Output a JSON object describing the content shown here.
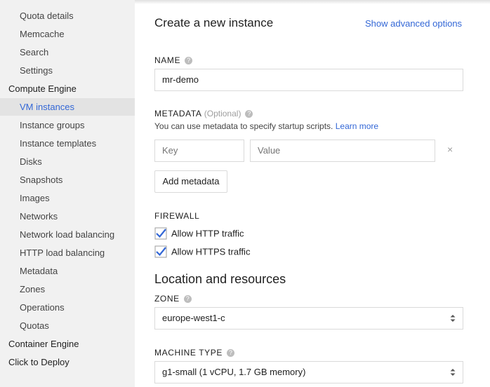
{
  "sidebar": {
    "items": [
      {
        "label": "Quota details",
        "kind": "item"
      },
      {
        "label": "Memcache",
        "kind": "item"
      },
      {
        "label": "Search",
        "kind": "item"
      },
      {
        "label": "Settings",
        "kind": "item"
      },
      {
        "label": "Compute Engine",
        "kind": "section"
      },
      {
        "label": "VM instances",
        "kind": "item",
        "active": true
      },
      {
        "label": "Instance groups",
        "kind": "item"
      },
      {
        "label": "Instance templates",
        "kind": "item"
      },
      {
        "label": "Disks",
        "kind": "item"
      },
      {
        "label": "Snapshots",
        "kind": "item"
      },
      {
        "label": "Images",
        "kind": "item"
      },
      {
        "label": "Networks",
        "kind": "item"
      },
      {
        "label": "Network load balancing",
        "kind": "item"
      },
      {
        "label": "HTTP load balancing",
        "kind": "item"
      },
      {
        "label": "Metadata",
        "kind": "item"
      },
      {
        "label": "Zones",
        "kind": "item"
      },
      {
        "label": "Operations",
        "kind": "item"
      },
      {
        "label": "Quotas",
        "kind": "item"
      },
      {
        "label": "Container Engine",
        "kind": "section"
      },
      {
        "label": "Click to Deploy",
        "kind": "section"
      }
    ]
  },
  "main": {
    "title": "Create a new instance",
    "advanced_link": "Show advanced options",
    "name": {
      "label": "NAME",
      "value": "mr-demo"
    },
    "metadata": {
      "label": "METADATA",
      "optional": "(Optional)",
      "hint": "You can use metadata to specify startup scripts.",
      "learn_more": "Learn more",
      "key_placeholder": "Key",
      "value_placeholder": "Value",
      "remove_glyph": "×",
      "add_button": "Add metadata"
    },
    "firewall": {
      "label": "FIREWALL",
      "http": {
        "label": "Allow HTTP traffic",
        "checked": true
      },
      "https": {
        "label": "Allow HTTPS traffic",
        "checked": true
      }
    },
    "location_title": "Location and resources",
    "zone": {
      "label": "ZONE",
      "value": "europe-west1-c"
    },
    "machine_type": {
      "label": "MACHINE TYPE",
      "value": "g1-small (1 vCPU, 1.7 GB memory)"
    },
    "help_glyph": "?"
  },
  "colors": {
    "accent": "#3367d6",
    "sidebar_bg": "#f1f1f1",
    "active_bg": "#e3e3e3"
  }
}
